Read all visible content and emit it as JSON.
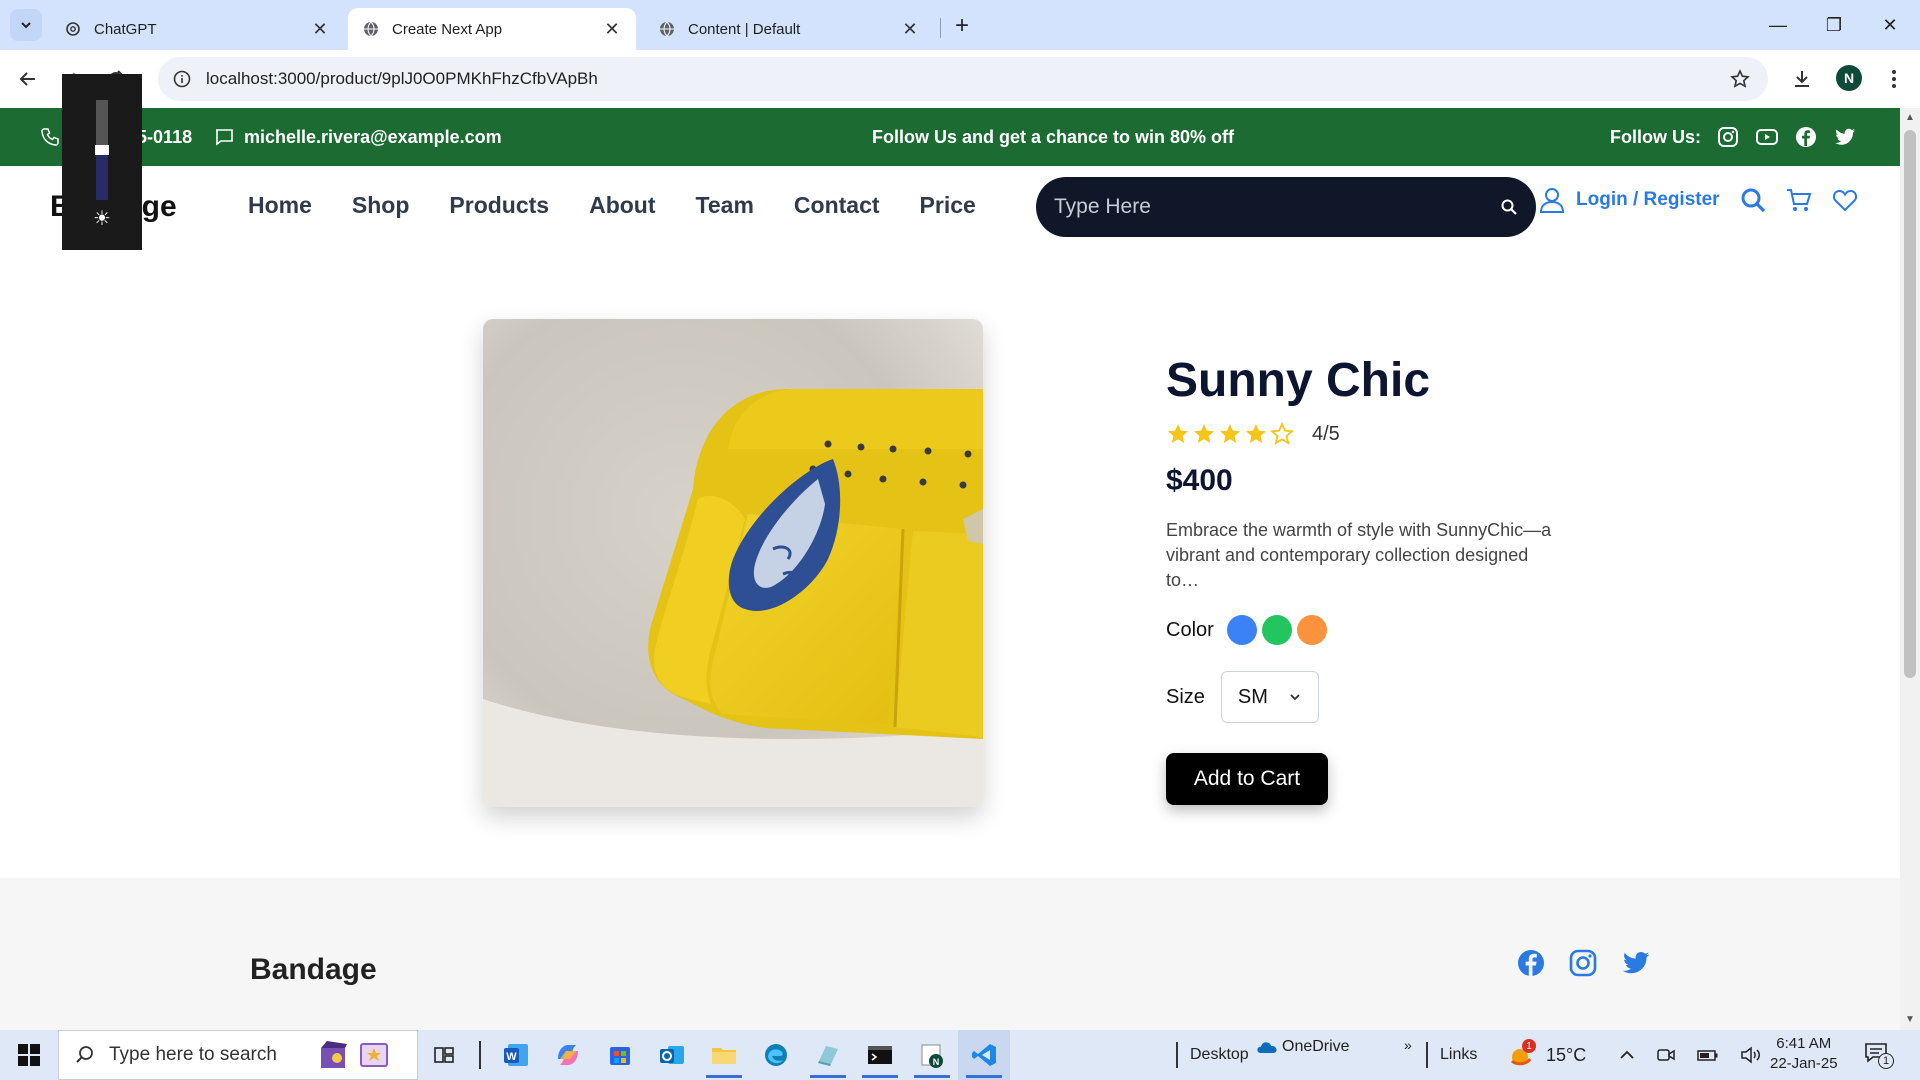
{
  "browser": {
    "tabs": [
      {
        "title": "ChatGPT",
        "icon": "chatgpt-icon",
        "active": false
      },
      {
        "title": "Create Next App",
        "icon": "globe-icon",
        "active": true
      },
      {
        "title": "Content | Default",
        "icon": "globe-icon",
        "active": false
      }
    ],
    "url": "localhost:3000/product/9plJ0O0PMKhFhzCfbVApBh",
    "profile_initial": "N"
  },
  "topbar": {
    "phone": "(225) 555-0118",
    "email": "michelle.rivera@example.com",
    "promo": "Follow Us and get a chance to win 80% off",
    "follow_label": "Follow Us:"
  },
  "header": {
    "brand": "Bandage",
    "nav": [
      "Home",
      "Shop",
      "Products",
      "About",
      "Team",
      "Contact",
      "Price"
    ],
    "search_placeholder": "Type Here",
    "login_label": "Login / Register"
  },
  "product": {
    "name": "Sunny Chic",
    "rating": 4,
    "rating_max": 5,
    "rating_text": "4/5",
    "price": "$400",
    "description": "Embrace the warmth of style with SunnyChic—a vibrant and contemporary collection designed to…",
    "color_label": "Color",
    "colors": [
      "#3b82f6",
      "#22c55e",
      "#fb923c"
    ],
    "size_label": "Size",
    "size_value": "SM",
    "add_to_cart": "Add to Cart"
  },
  "footer": {
    "brand": "Bandage"
  },
  "taskbar": {
    "search_placeholder": "Type here to search",
    "desktop_label": "Desktop",
    "onedrive_label": "OneDrive",
    "links_label": "Links",
    "weather": "15°C",
    "weather_badge": "1",
    "time": "6:41 AM",
    "date": "22-Jan-25",
    "notification_count": "1"
  },
  "colors": {
    "topbar_green": "#1c6b32",
    "accent_blue": "#2a7ae2",
    "search_dark": "#0f1729",
    "star_gold": "#f5c518"
  }
}
